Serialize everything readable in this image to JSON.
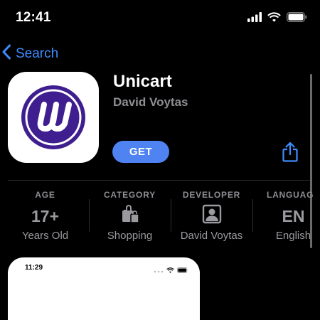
{
  "status_bar": {
    "time": "12:41"
  },
  "nav": {
    "back_label": "Search"
  },
  "app": {
    "title": "Unicart",
    "developer": "David Voytas",
    "get_label": "GET"
  },
  "info": [
    {
      "header": "AGE",
      "value": "17+",
      "sub": "Years Old"
    },
    {
      "header": "CATEGORY",
      "icon": "shopping-bag-icon",
      "sub": "Shopping"
    },
    {
      "header": "DEVELOPER",
      "icon": "person-icon",
      "sub": "David Voytas"
    },
    {
      "header": "LANGUAGE",
      "value": "EN",
      "sub": "English"
    }
  ],
  "preview": {
    "time": "11:29"
  },
  "colors": {
    "accent": "#4f83f1",
    "link": "#3f8cff",
    "brand": "#3f1f8f"
  }
}
